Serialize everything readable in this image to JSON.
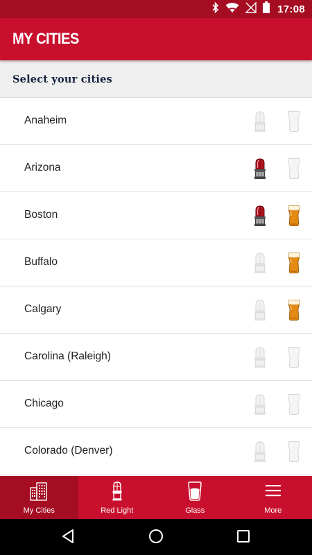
{
  "status_bar": {
    "time": "17:08",
    "icons": [
      "bluetooth-icon",
      "wifi-icon",
      "no-signal-icon",
      "battery-icon"
    ]
  },
  "app_bar": {
    "title": "MY CITIES"
  },
  "subheader": {
    "text": "Select your cities"
  },
  "cities": [
    {
      "name": "Anaheim",
      "red_light_on": false,
      "glass_on": false
    },
    {
      "name": "Arizona",
      "red_light_on": true,
      "glass_on": false
    },
    {
      "name": "Boston",
      "red_light_on": true,
      "glass_on": true
    },
    {
      "name": "Buffalo",
      "red_light_on": false,
      "glass_on": true
    },
    {
      "name": "Calgary",
      "red_light_on": false,
      "glass_on": true
    },
    {
      "name": "Carolina (Raleigh)",
      "red_light_on": false,
      "glass_on": false
    },
    {
      "name": "Chicago",
      "red_light_on": false,
      "glass_on": false
    },
    {
      "name": "Colorado (Denver)",
      "red_light_on": false,
      "glass_on": false
    }
  ],
  "bottom_nav": {
    "tabs": [
      {
        "label": "My Cities",
        "icon": "city-buildings-icon",
        "active": true
      },
      {
        "label": "Red Light",
        "icon": "goal-light-icon",
        "active": false
      },
      {
        "label": "Glass",
        "icon": "beer-glass-icon",
        "active": false
      },
      {
        "label": "More",
        "icon": "menu-icon",
        "active": false
      }
    ]
  },
  "system_nav": {
    "buttons": [
      "back-icon",
      "home-icon",
      "recents-icon"
    ]
  },
  "colors": {
    "brand_red": "#c8102e",
    "brand_red_dark": "#a50d22",
    "subheader_bg": "#efefef",
    "subheader_text": "#14213d",
    "light_on": "#b3121f",
    "beer_on": "#e58a12"
  }
}
